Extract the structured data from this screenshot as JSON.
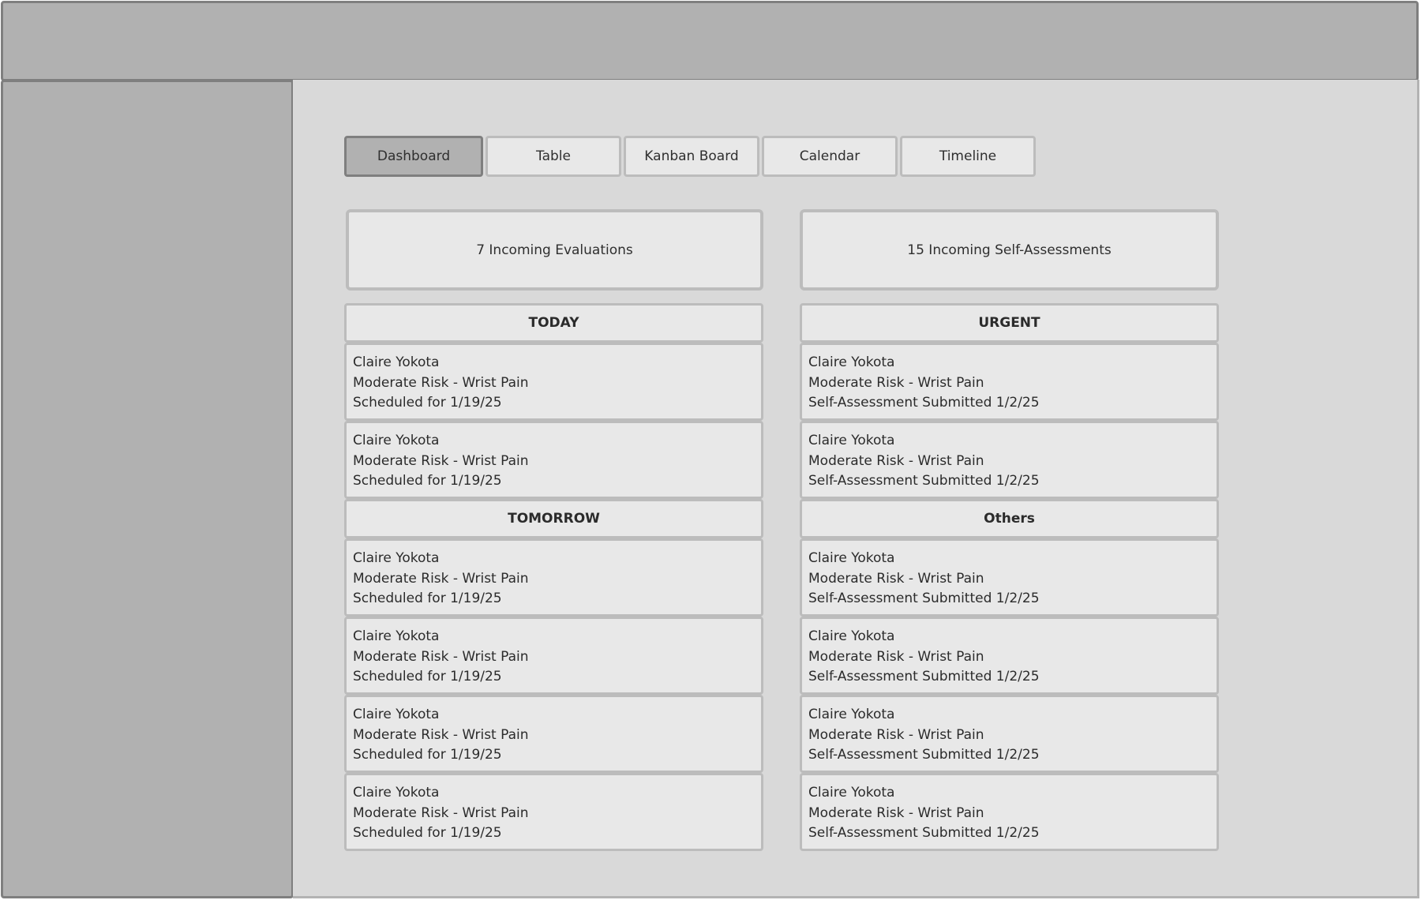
{
  "tabs": [
    {
      "label": "Dashboard",
      "active": true
    },
    {
      "label": "Table",
      "active": false
    },
    {
      "label": "Kanban Board",
      "active": false
    },
    {
      "label": "Calendar",
      "active": false
    },
    {
      "label": "Timeline",
      "active": false
    }
  ],
  "summary": {
    "evaluations": "7 Incoming Evaluations",
    "self_assessments": "15 Incoming Self-Assessments"
  },
  "left_column": {
    "sections": [
      {
        "title": "TODAY",
        "cards": [
          {
            "name": "Claire Yokota",
            "risk": "Moderate Risk - Wrist Pain",
            "detail": "Scheduled for 1/19/25"
          },
          {
            "name": "Claire Yokota",
            "risk": "Moderate Risk - Wrist Pain",
            "detail": "Scheduled for 1/19/25"
          }
        ]
      },
      {
        "title": "TOMORROW",
        "cards": [
          {
            "name": "Claire Yokota",
            "risk": "Moderate Risk - Wrist Pain",
            "detail": "Scheduled for 1/19/25"
          },
          {
            "name": "Claire Yokota",
            "risk": "Moderate Risk - Wrist Pain",
            "detail": "Scheduled for 1/19/25"
          },
          {
            "name": "Claire Yokota",
            "risk": "Moderate Risk - Wrist Pain",
            "detail": "Scheduled for 1/19/25"
          },
          {
            "name": "Claire Yokota",
            "risk": "Moderate Risk - Wrist Pain",
            "detail": "Scheduled for 1/19/25"
          }
        ]
      }
    ]
  },
  "right_column": {
    "sections": [
      {
        "title": "URGENT",
        "cards": [
          {
            "name": "Claire Yokota",
            "risk": "Moderate Risk - Wrist Pain",
            "detail": "Self-Assessment Submitted 1/2/25"
          },
          {
            "name": "Claire Yokota",
            "risk": "Moderate Risk - Wrist Pain",
            "detail": "Self-Assessment Submitted 1/2/25"
          }
        ]
      },
      {
        "title": "Others",
        "cards": [
          {
            "name": "Claire Yokota",
            "risk": "Moderate Risk - Wrist Pain",
            "detail": "Self-Assessment Submitted 1/2/25"
          },
          {
            "name": "Claire Yokota",
            "risk": "Moderate Risk - Wrist Pain",
            "detail": "Self-Assessment Submitted 1/2/25"
          },
          {
            "name": "Claire Yokota",
            "risk": "Moderate Risk - Wrist Pain",
            "detail": "Self-Assessment Submitted 1/2/25"
          },
          {
            "name": "Claire Yokota",
            "risk": "Moderate Risk - Wrist Pain",
            "detail": "Self-Assessment Submitted 1/2/25"
          }
        ]
      }
    ]
  }
}
